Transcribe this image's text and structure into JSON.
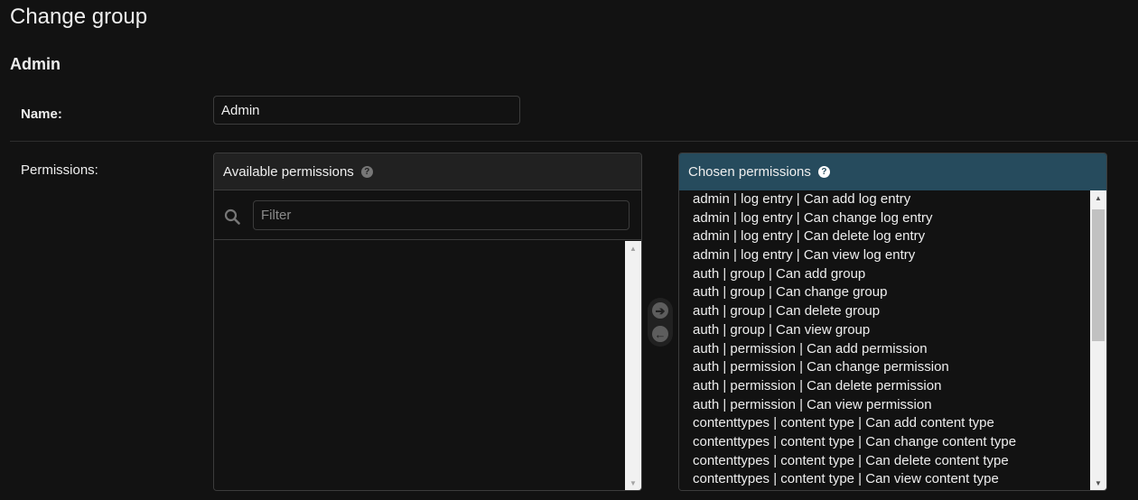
{
  "page": {
    "title": "Change group"
  },
  "fieldset": {
    "title": "Admin"
  },
  "name_field": {
    "label": "Name:",
    "value": "Admin"
  },
  "permissions_field": {
    "label": "Permissions:",
    "available": {
      "title": "Available permissions",
      "help_icon": "question-circle-icon",
      "filter_placeholder": "Filter",
      "filter_icon": "search-icon",
      "options": []
    },
    "chosen": {
      "title": "Chosen permissions",
      "help_icon": "question-circle-icon",
      "options": [
        "admin | log entry | Can add log entry",
        "admin | log entry | Can change log entry",
        "admin | log entry | Can delete log entry",
        "admin | log entry | Can view log entry",
        "auth | group | Can add group",
        "auth | group | Can change group",
        "auth | group | Can delete group",
        "auth | group | Can view group",
        "auth | permission | Can add permission",
        "auth | permission | Can change permission",
        "auth | permission | Can delete permission",
        "auth | permission | Can view permission",
        "contenttypes | content type | Can add content type",
        "contenttypes | content type | Can change content type",
        "contenttypes | content type | Can delete content type",
        "contenttypes | content type | Can view content type"
      ]
    },
    "chooser": {
      "add_icon": "arrow-right-circle-icon",
      "remove_icon": "arrow-left-circle-icon"
    }
  },
  "colors": {
    "header_accent": "#264b5d",
    "background": "#121212"
  }
}
